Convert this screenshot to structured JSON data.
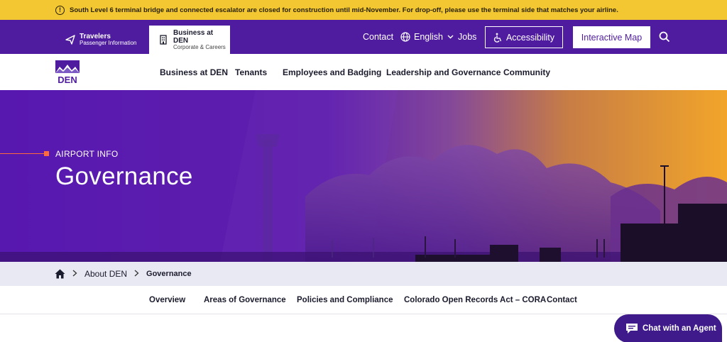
{
  "alert": {
    "icon": "warning-circle-icon",
    "text": "South Level 6 terminal bridge and connected escalator are closed for construction until mid-November. For drop-off, please use the terminal side that matches your airline."
  },
  "utility": {
    "travelers": {
      "title": "Travelers",
      "subtitle": "Passenger Information",
      "icon": "paper-plane-icon"
    },
    "business": {
      "title": "Business at DEN",
      "subtitle": "Corporate & Careers",
      "icon": "building-icon"
    },
    "contact": "Contact",
    "language": "English",
    "jobs": "Jobs",
    "accessibility": "Accessibility",
    "interactive_map": "Interactive Map",
    "search_icon": "search-icon"
  },
  "logo": {
    "text": "DEN"
  },
  "mainnav": [
    "Business at DEN",
    "Tenants",
    "Employees and Badging",
    "Leadership and Governance",
    "Community"
  ],
  "hero": {
    "eyebrow": "AIRPORT INFO",
    "title": "Governance"
  },
  "breadcrumb": {
    "parent": "About DEN",
    "current": "Governance"
  },
  "subnav": [
    "Overview",
    "Areas of Governance",
    "Policies and Compliance",
    "Colorado Open Records Act – CORA",
    "Contact"
  ],
  "chat": {
    "label": "Chat with an Agent"
  },
  "colors": {
    "brand_purple": "#4f1ca0",
    "alert_yellow": "#f3c732",
    "accent_orange": "#ff6a3d"
  }
}
